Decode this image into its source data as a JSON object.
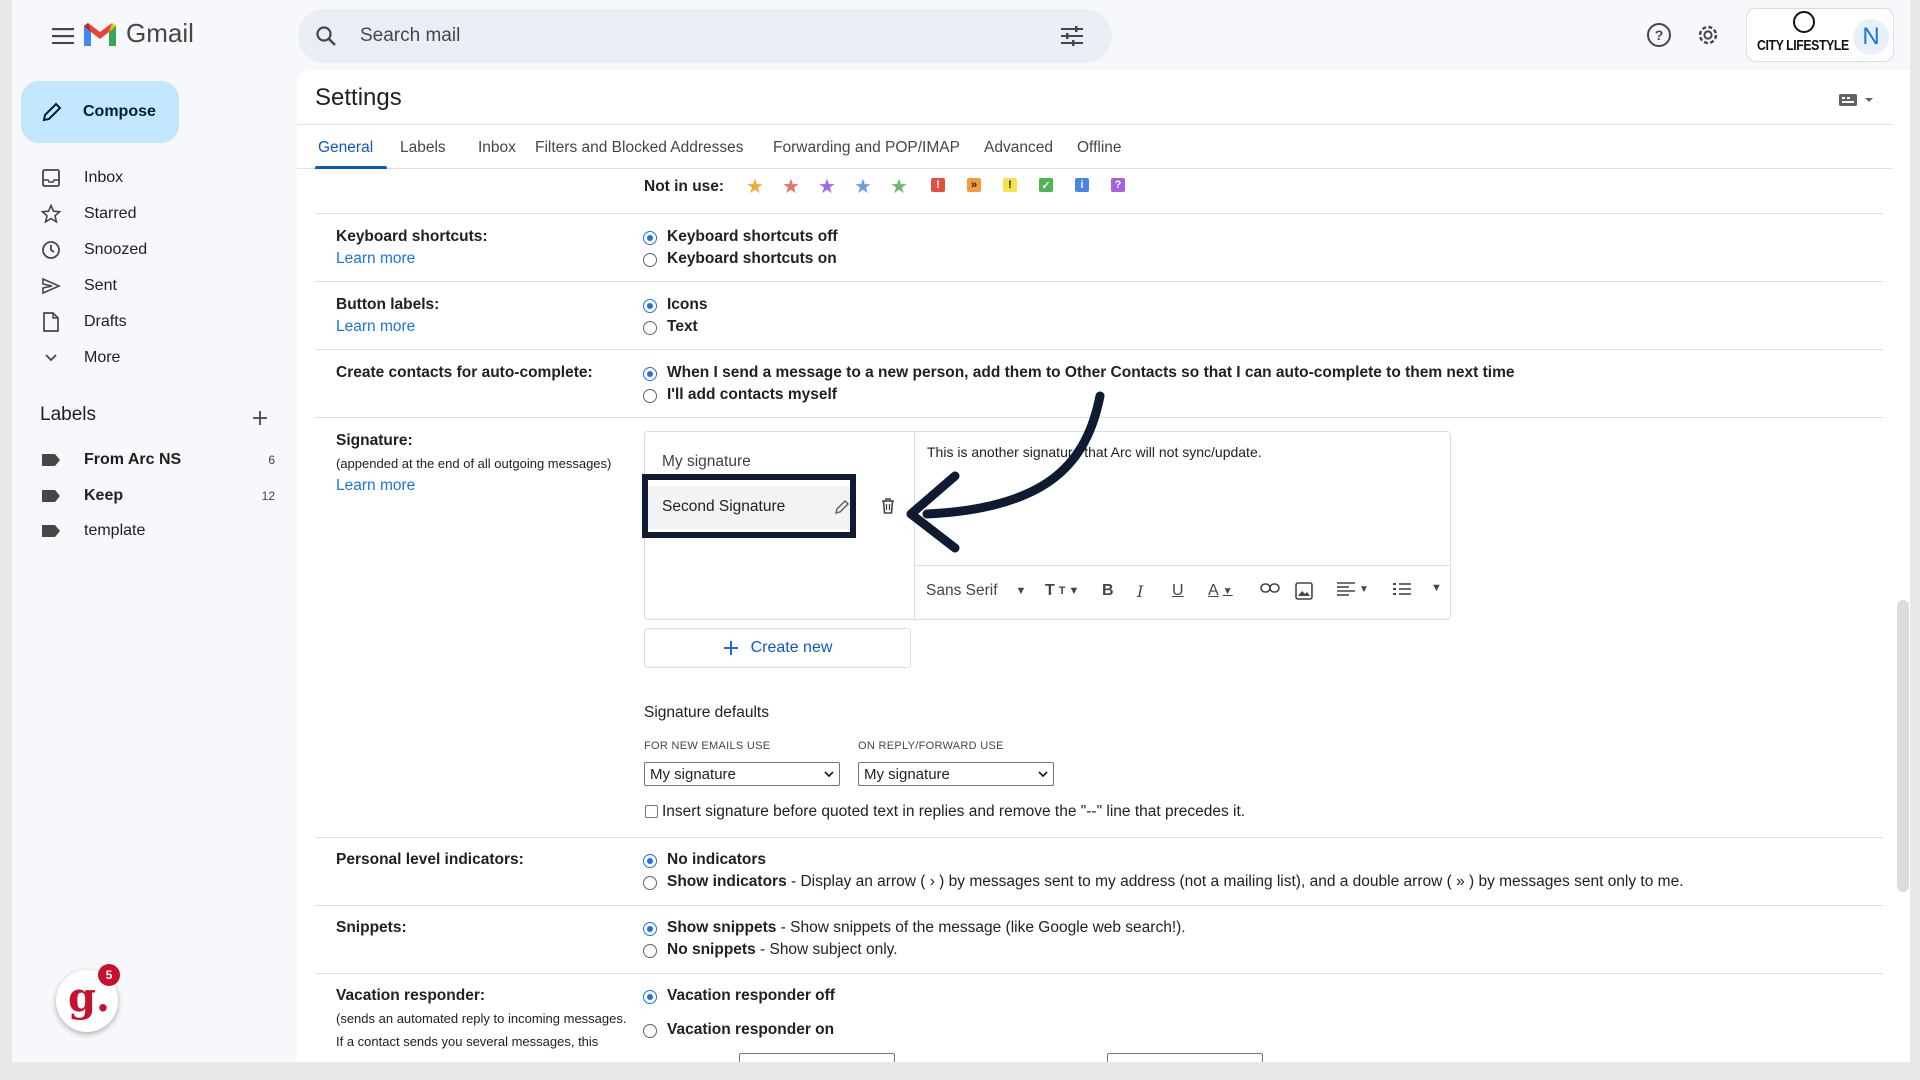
{
  "app": {
    "name": "Gmail"
  },
  "search": {
    "placeholder": "Search mail"
  },
  "account": {
    "brand": "CITY LIFESTYLE",
    "avatar_letter": "N"
  },
  "sidebar": {
    "compose_label": "Compose",
    "items": [
      {
        "label": "Inbox",
        "icon": "inbox-icon"
      },
      {
        "label": "Starred",
        "icon": "star-icon"
      },
      {
        "label": "Snoozed",
        "icon": "clock-icon"
      },
      {
        "label": "Sent",
        "icon": "send-icon"
      },
      {
        "label": "Drafts",
        "icon": "draft-icon"
      },
      {
        "label": "More",
        "icon": "chevron-down-icon"
      }
    ],
    "labels_heading": "Labels",
    "labels": [
      {
        "name": "From Arc NS",
        "count": "6",
        "bold": true
      },
      {
        "name": "Keep",
        "count": "12",
        "bold": true
      },
      {
        "name": "template",
        "count": "",
        "bold": false
      }
    ]
  },
  "settings": {
    "title": "Settings",
    "tabs": [
      "General",
      "Labels",
      "Inbox",
      "Filters and Blocked Addresses",
      "Forwarding and POP/IMAP",
      "Advanced",
      "Offline"
    ],
    "active_tab": "General",
    "not_in_use_label": "Not in use:",
    "keyboard": {
      "label": "Keyboard shortcuts:",
      "learn_more": "Learn more",
      "opt_off": "Keyboard shortcuts off",
      "opt_on": "Keyboard shortcuts on",
      "selected": "off"
    },
    "button_labels": {
      "label": "Button labels:",
      "learn_more": "Learn more",
      "opt_icons": "Icons",
      "opt_text": "Text",
      "selected": "icons"
    },
    "contacts": {
      "label": "Create contacts for auto-complete:",
      "opt_auto": "When I send a message to a new person, add them to Other Contacts so that I can auto-complete to them next time",
      "opt_manual": "I'll add contacts myself",
      "selected": "auto"
    },
    "signature": {
      "label": "Signature:",
      "sublabel": "(appended at the end of all outgoing messages)",
      "learn_more": "Learn more",
      "list": [
        "My signature",
        "Second Signature"
      ],
      "selected": "Second Signature",
      "editor_text": "This is another signature that Arc will not sync/update.",
      "font": "Sans Serif",
      "create_new": "Create new",
      "defaults_heading": "Signature defaults",
      "new_emails_label": "FOR NEW EMAILS USE",
      "reply_label": "ON REPLY/FORWARD USE",
      "new_emails_value": "My signature",
      "reply_value": "My signature",
      "insert_before": "Insert signature before quoted text in replies and remove the \"--\" line that precedes it."
    },
    "personal_indicators": {
      "label": "Personal level indicators:",
      "opt_none": "No indicators",
      "opt_show": "Show indicators",
      "opt_show_desc": " - Display an arrow ( › ) by messages sent to my address (not a mailing list), and a double arrow ( » ) by messages sent only to me.",
      "selected": "none"
    },
    "snippets": {
      "label": "Snippets:",
      "opt_show": "Show snippets",
      "opt_show_desc": " - Show snippets of the message (like Google web search!).",
      "opt_none": "No snippets",
      "opt_none_desc": " - Show subject only.",
      "selected": "show"
    },
    "vacation": {
      "label": "Vacation responder:",
      "sublabel1": "(sends an automated reply to incoming messages.",
      "sublabel2": "If a contact sends you several messages, this",
      "opt_off": "Vacation responder off",
      "opt_on": "Vacation responder on",
      "selected": "off"
    }
  },
  "colors": {
    "accent": "#0b57d0",
    "compose_bg": "#c2e7ff",
    "highlight_border": "#0f1b33"
  }
}
